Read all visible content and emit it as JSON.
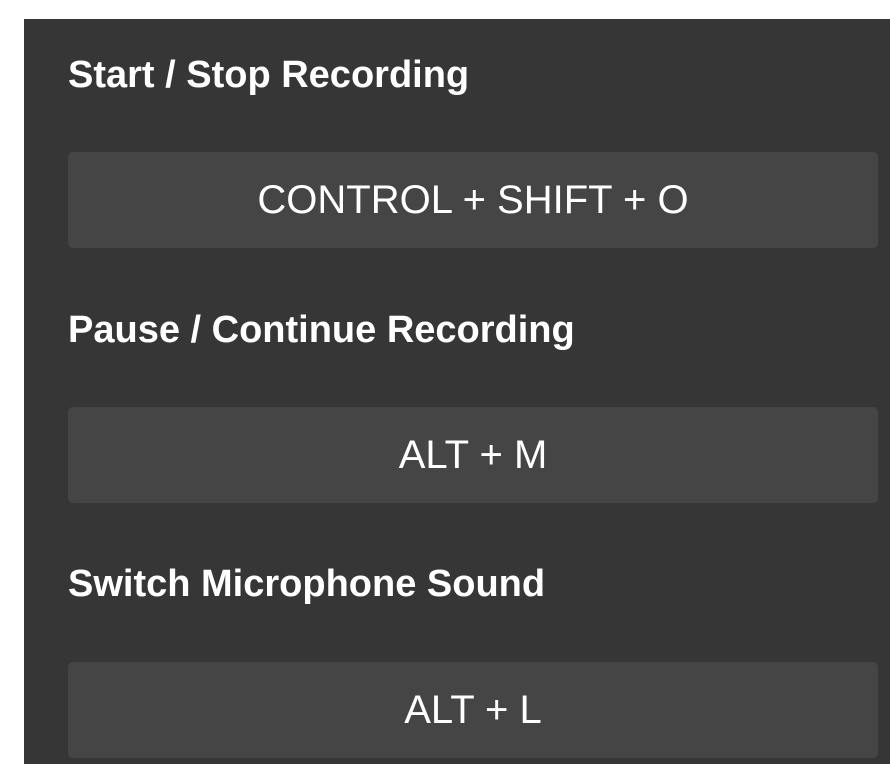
{
  "shortcuts": [
    {
      "title": "Start / Stop Recording",
      "keys": "CONTROL + SHIFT + O"
    },
    {
      "title": "Pause / Continue Recording",
      "keys": "ALT + M"
    },
    {
      "title": "Switch Microphone Sound",
      "keys": "ALT + L"
    }
  ]
}
